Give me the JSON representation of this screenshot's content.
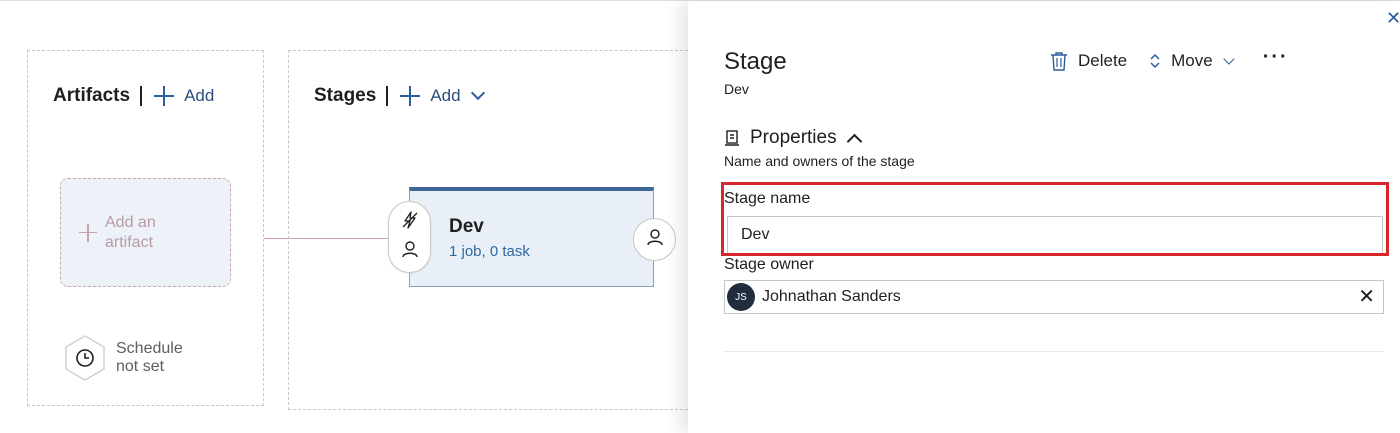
{
  "canvas": {
    "artifacts": {
      "title": "Artifacts",
      "add_label": "Add",
      "add_artifact_label": "Add an artifact",
      "schedule_label": "Schedule not set"
    },
    "stages": {
      "title": "Stages",
      "add_label": "Add",
      "stage_card": {
        "name": "Dev",
        "summary": "1 job, 0 task"
      }
    }
  },
  "panel": {
    "title": "Stage",
    "subtitle": "Dev",
    "toolbar": {
      "delete_label": "Delete",
      "move_label": "Move",
      "more_label": "···"
    },
    "properties": {
      "heading": "Properties",
      "description": "Name and owners of the stage",
      "stage_name_label": "Stage name",
      "stage_name_value": "Dev",
      "stage_owner_label": "Stage owner",
      "owner": {
        "initials": "JS",
        "name": "Johnathan Sanders",
        "clear_label": "✕"
      }
    },
    "close_label": "✕"
  },
  "colors": {
    "accent": "#2b5d9a",
    "highlight": "#d8262c",
    "stage_card_bg": "#e9eff6",
    "connector": "#d8a0ab"
  },
  "icons": {
    "close": "close-icon",
    "delete": "trash-icon",
    "move": "sort-arrows-icon",
    "more": "more-icon",
    "properties": "properties-icon",
    "schedule": "clock-icon",
    "trigger": "lightning-icon",
    "approver": "person-icon",
    "add": "plus-icon"
  }
}
